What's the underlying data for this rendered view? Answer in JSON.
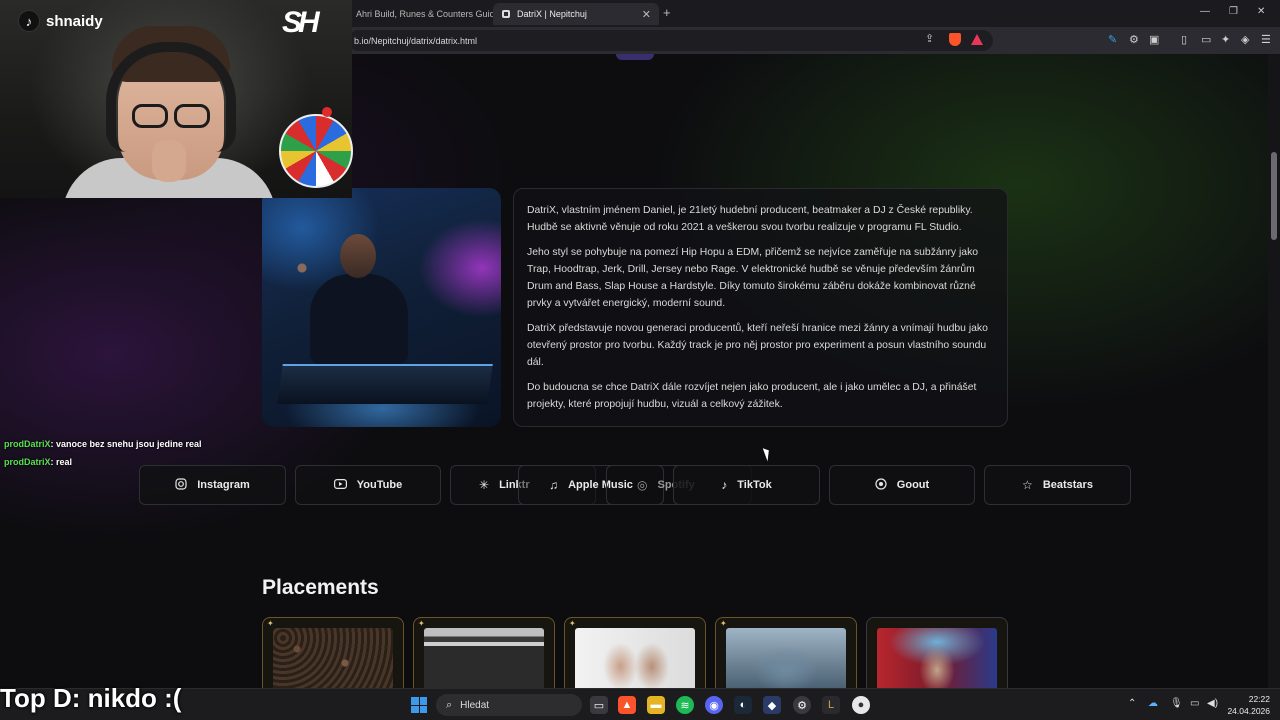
{
  "browser": {
    "tabs": [
      {
        "title": "Ahri Build, Runes & Counters Guide |"
      },
      {
        "title": "DatriX | Nepitchuj"
      }
    ],
    "url": "b.io/Nepitchuj/datrix/datrix.html"
  },
  "about": {
    "paragraphs": [
      "DatriX, vlastním jménem Daniel, je 21letý hudební producent, beatmaker a DJ z České republiky. Hudbě se aktivně věnuje od roku 2021 a veškerou svou tvorbu realizuje v programu FL Studio.",
      "Jeho styl se pohybuje na pomezí Hip Hopu a EDM, přičemž se nejvíce zaměřuje na subžánry jako Trap, Hoodtrap, Jerk, Drill, Jersey nebo Rage. V elektronické hudbě se věnuje především žánrům Drum and Bass, Slap House a Hardstyle. Díky tomuto širokému záběru dokáže kombinovat různé prvky a vytvářet energický, moderní sound.",
      "DatriX představuje novou generaci producentů, kteří neřeší hranice mezi žánry a vnímají hudbu jako otevřený prostor pro tvorbu. Každý track je pro něj prostor pro experiment a posun vlastního soundu dál.",
      "Do budoucna se chce DatriX dále rozvíjet nejen jako producent, ale i jako umělec a DJ, a přinášet projekty, které propojují hudbu, vizuál a celkový zážitek."
    ]
  },
  "links": {
    "instagram": "Instagram",
    "youtube": "YouTube",
    "linktree": "Linktr",
    "apple_music": "Apple Music",
    "spotify": "Spotify",
    "tiktok": "TikTok",
    "goout": "Goout",
    "beatstars": "Beatstars"
  },
  "placements": {
    "title": "Placements"
  },
  "overlay": {
    "tiktok_handle": "shnaidy",
    "logo_text": "SH",
    "chat": [
      {
        "user": "prodDatriX",
        "message": ": vanoce bez snehu jsou jedine real"
      },
      {
        "user": "prodDatriX",
        "message": ": real"
      }
    ],
    "top_donor": "Top D: nikdo :("
  },
  "taskbar": {
    "search_placeholder": "Hledat",
    "time": "22:22",
    "date": "24.04.2026"
  },
  "colors": {
    "chat_user": "#59e04f",
    "accent_brave": "#fb542b",
    "placement_border": "#6a5528"
  }
}
